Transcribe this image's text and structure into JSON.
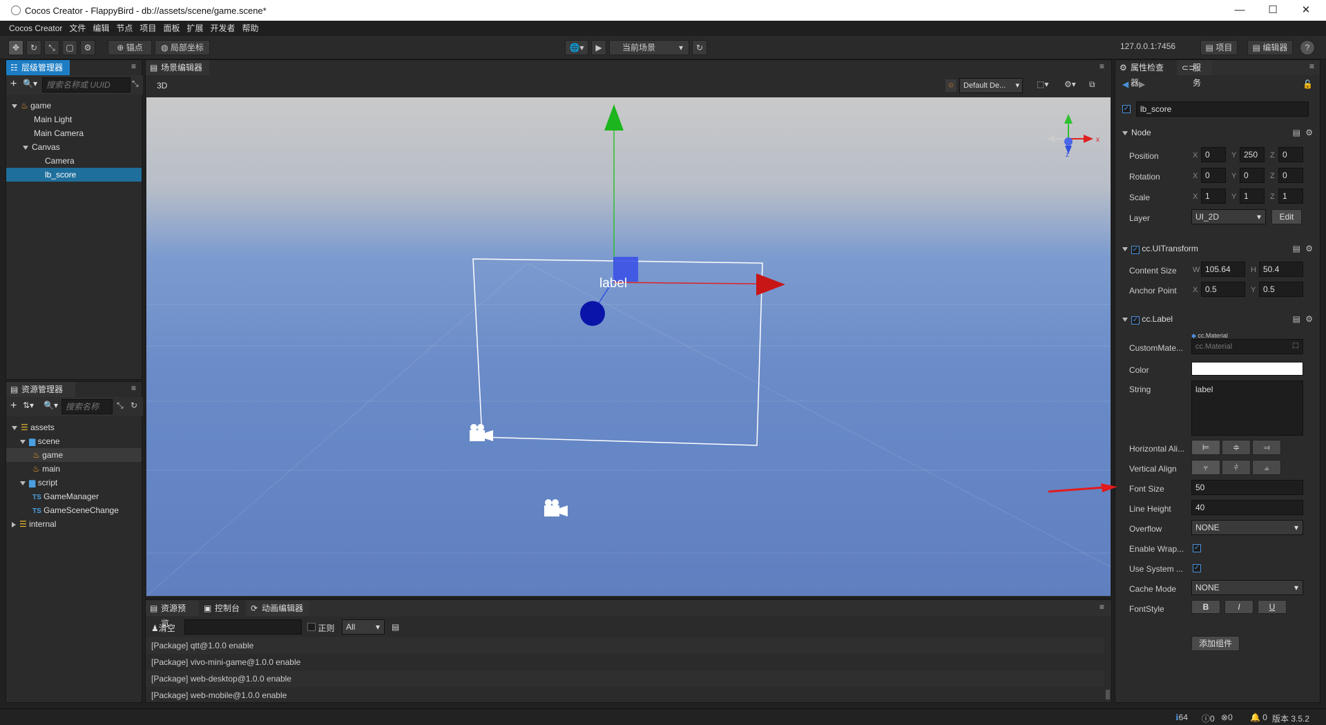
{
  "window": {
    "title": "Cocos Creator - FlappyBird - db://assets/scene/game.scene*",
    "minimize": "—",
    "maximize": "☐",
    "close": "✕"
  },
  "menu": [
    "Cocos Creator",
    "文件",
    "编辑",
    "节点",
    "项目",
    "面板",
    "扩展",
    "开发者",
    "帮助"
  ],
  "toolbar": {
    "pivot": "锚点",
    "local": "局部坐标",
    "scene_select": "当前场景",
    "ip": "127.0.0.1:7456",
    "project": "项目",
    "editor": "编辑器",
    "help": "?"
  },
  "hierarchy": {
    "tab": "层级管理器",
    "search_placeholder": "搜索名称或 UUID",
    "nodes": [
      {
        "label": "game"
      },
      {
        "label": "Main Light"
      },
      {
        "label": "Main Camera"
      },
      {
        "label": "Canvas"
      },
      {
        "label": "Camera"
      },
      {
        "label": "lb_score"
      }
    ]
  },
  "assets": {
    "tab": "资源管理器",
    "search_placeholder": "搜索名称",
    "items": [
      {
        "label": "assets"
      },
      {
        "label": "scene"
      },
      {
        "label": "game"
      },
      {
        "label": "main"
      },
      {
        "label": "script"
      },
      {
        "label": "GameManager",
        "prefix": "TS"
      },
      {
        "label": "GameSceneChange",
        "prefix": "TS"
      },
      {
        "label": "internal"
      }
    ]
  },
  "scene": {
    "tab": "场景编辑器",
    "mode": "3D",
    "camera_select": "Default De...",
    "label_text": "label"
  },
  "console": {
    "tabs": [
      "资源预览",
      "控制台",
      "动画编辑器"
    ],
    "clear": "清空",
    "regex": "正则",
    "filter": "All",
    "logs": [
      "[Package] qtt@1.0.0 enable",
      "[Package] vivo-mini-game@1.0.0 enable",
      "[Package] web-desktop@1.0.0 enable",
      "[Package] web-mobile@1.0.0 enable"
    ]
  },
  "inspector": {
    "tab": "属性检查器",
    "tab2": "服务",
    "node_name": "lb_score",
    "node": {
      "title": "Node",
      "position_label": "Position",
      "pos": [
        "0",
        "250",
        "0"
      ],
      "rotation_label": "Rotation",
      "rot": [
        "0",
        "0",
        "0"
      ],
      "scale_label": "Scale",
      "scale": [
        "1",
        "1",
        "1"
      ],
      "layer_label": "Layer",
      "layer": "UI_2D",
      "edit": "Edit"
    },
    "uitransform": {
      "title": "cc.UITransform",
      "content_label": "Content Size",
      "w": "105.64",
      "h": "50.4",
      "anchor_label": "Anchor Point",
      "ax": "0.5",
      "ay": "0.5"
    },
    "label": {
      "title": "cc.Label",
      "custom_mat_label": "CustomMate...",
      "mat_tag": "cc.Material",
      "mat_placeholder": "cc.Material",
      "color_label": "Color",
      "string_label": "String",
      "string": "label",
      "halign_label": "Horizontal Ali...",
      "valign_label": "Vertical Align",
      "font_size_label": "Font Size",
      "font_size": "50",
      "line_height_label": "Line Height",
      "line_height": "40",
      "overflow_label": "Overflow",
      "overflow": "NONE",
      "wrap_label": "Enable Wrap...",
      "system_label": "Use System ...",
      "cache_label": "Cache Mode",
      "cache": "NONE",
      "fontstyle_label": "FontStyle",
      "b": "B",
      "i": "I",
      "u": "U"
    },
    "add_component": "添加组件"
  },
  "status": {
    "info": "64",
    "warn": "0",
    "err": "0",
    "notice": "0",
    "version": "版本 3.5.2"
  }
}
